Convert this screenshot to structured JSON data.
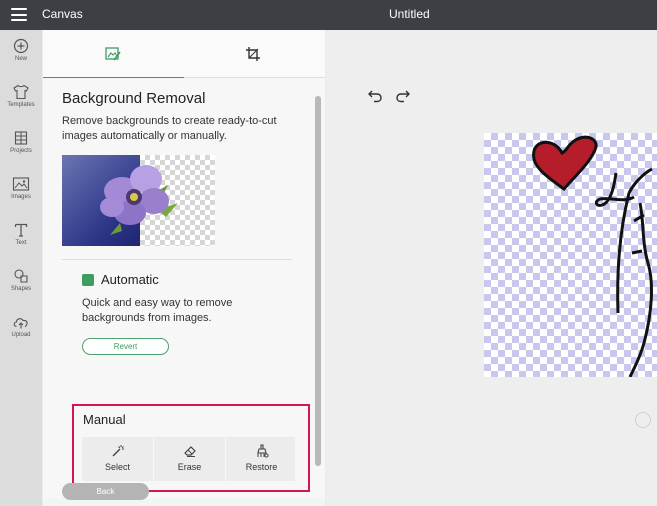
{
  "topbar": {
    "app_title": "Canvas",
    "doc_title": "Untitled"
  },
  "rail": {
    "items": [
      {
        "label": "New",
        "icon": "plus-circle-icon"
      },
      {
        "label": "Templates",
        "icon": "shirt-icon"
      },
      {
        "label": "Projects",
        "icon": "projects-icon"
      },
      {
        "label": "Images",
        "icon": "image-icon"
      },
      {
        "label": "Text",
        "icon": "text-icon"
      },
      {
        "label": "Shapes",
        "icon": "shapes-icon"
      },
      {
        "label": "Upload",
        "icon": "upload-cloud-icon"
      }
    ]
  },
  "panel": {
    "tabs": [
      {
        "icon": "background-removal-icon",
        "active": true
      },
      {
        "icon": "crop-icon",
        "active": false
      }
    ],
    "title": "Background Removal",
    "description": "Remove backgrounds to create ready-to-cut images automatically or manually.",
    "automatic": {
      "title": "Automatic",
      "description": "Quick and easy way to remove backgrounds from images.",
      "revert_label": "Revert"
    },
    "manual": {
      "title": "Manual",
      "tools": [
        {
          "label": "Select",
          "icon": "magic-wand-icon"
        },
        {
          "label": "Erase",
          "icon": "eraser-icon"
        },
        {
          "label": "Restore",
          "icon": "restore-brush-icon"
        }
      ]
    },
    "back_label": "Back"
  },
  "canvas": {
    "undo_icon": "undo-icon",
    "redo_icon": "redo-icon"
  },
  "colors": {
    "accent": "#3e9c5f",
    "highlight": "#d4154f",
    "topbar": "#3c3f44"
  }
}
